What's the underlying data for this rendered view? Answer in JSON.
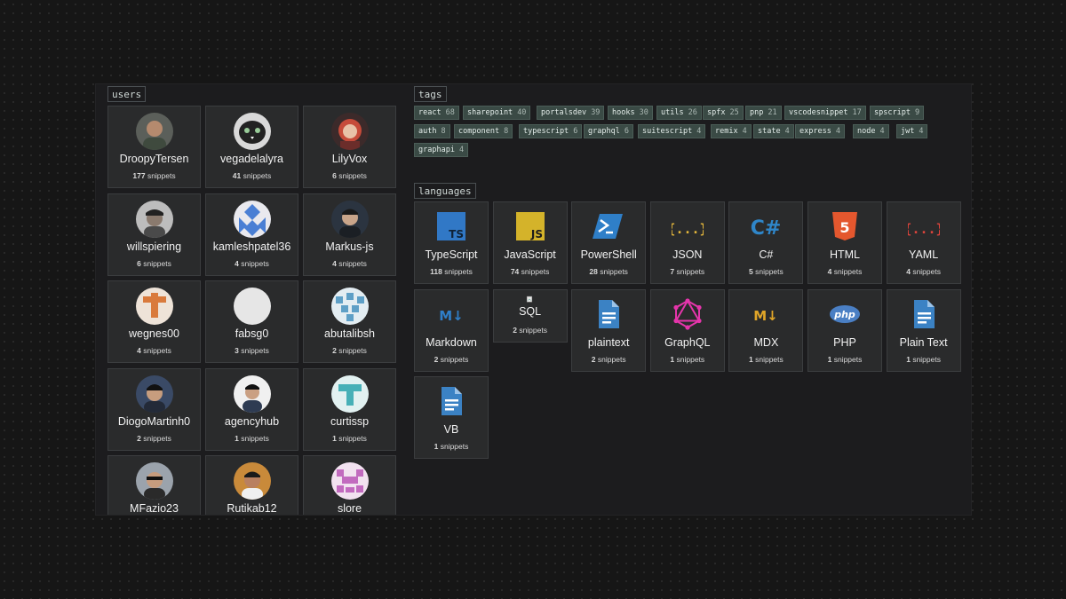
{
  "sections": {
    "users": "users",
    "tags": "tags",
    "languages": "languages"
  },
  "snippets_word": "snippets",
  "users": [
    {
      "name": "DroopyTersen",
      "count": "177"
    },
    {
      "name": "vegadelalyra",
      "count": "41"
    },
    {
      "name": "LilyVox",
      "count": "6"
    },
    {
      "name": "willspiering",
      "count": "6"
    },
    {
      "name": "kamleshpatel36",
      "count": "4"
    },
    {
      "name": "Markus-js",
      "count": "4"
    },
    {
      "name": "wegnes00",
      "count": "4"
    },
    {
      "name": "fabsg0",
      "count": "3"
    },
    {
      "name": "abutalibsh",
      "count": "2"
    },
    {
      "name": "DiogoMartinh0",
      "count": "2"
    },
    {
      "name": "agencyhub",
      "count": "1"
    },
    {
      "name": "curtissp",
      "count": "1"
    },
    {
      "name": "MFazio23",
      "count": ""
    },
    {
      "name": "Rutikab12",
      "count": ""
    },
    {
      "name": "slore",
      "count": ""
    }
  ],
  "tags": [
    {
      "name": "react",
      "count": "68"
    },
    {
      "name": "sharepoint",
      "count": "40"
    },
    {
      "name": "portalsdev",
      "count": "39"
    },
    {
      "name": "hooks",
      "count": "30"
    },
    {
      "name": "utils",
      "count": "26"
    },
    {
      "name": "spfx",
      "count": "25"
    },
    {
      "name": "pnp",
      "count": "21"
    },
    {
      "name": "vscodesnippet",
      "count": "17"
    },
    {
      "name": "spscript",
      "count": "9"
    },
    {
      "name": "auth",
      "count": "8"
    },
    {
      "name": "component",
      "count": "8"
    },
    {
      "name": "typescript",
      "count": "6"
    },
    {
      "name": "graphql",
      "count": "6"
    },
    {
      "name": "suitescript",
      "count": "4"
    },
    {
      "name": "remix",
      "count": "4"
    },
    {
      "name": "state",
      "count": "4"
    },
    {
      "name": "express",
      "count": "4"
    },
    {
      "name": "node",
      "count": "4"
    },
    {
      "name": "jwt",
      "count": "4"
    },
    {
      "name": "graphapi",
      "count": "4"
    }
  ],
  "languages": [
    {
      "name": "TypeScript",
      "count": "118",
      "icon": "typescript-icon",
      "color": "#3178c6",
      "label": "TS"
    },
    {
      "name": "JavaScript",
      "count": "74",
      "icon": "javascript-icon",
      "color": "#d4b32a",
      "label": "JS"
    },
    {
      "name": "PowerShell",
      "count": "28",
      "icon": "powershell-icon",
      "color": "#2f7fc8",
      "label": ""
    },
    {
      "name": "JSON",
      "count": "7",
      "icon": "json-icon",
      "color": "#e2b53b",
      "label": "{...}"
    },
    {
      "name": "C#",
      "count": "5",
      "icon": "csharp-icon",
      "color": "#2f86c9",
      "label": "C#"
    },
    {
      "name": "HTML",
      "count": "4",
      "icon": "html5-icon",
      "color": "#e4572e",
      "label": "5"
    },
    {
      "name": "YAML",
      "count": "4",
      "icon": "yaml-icon",
      "color": "#d9433b",
      "label": "{...}"
    },
    {
      "name": "Markdown",
      "count": "2",
      "icon": "markdown-icon",
      "color": "#2f7fc8",
      "label": "M↓"
    },
    {
      "name": "SQL",
      "count": "2",
      "icon": "broken-image-icon",
      "color": "#888888",
      "label": ""
    },
    {
      "name": "plaintext",
      "count": "2",
      "icon": "document-icon",
      "color": "#3b82c4",
      "label": ""
    },
    {
      "name": "GraphQL",
      "count": "1",
      "icon": "graphql-icon",
      "color": "#e535ab",
      "label": ""
    },
    {
      "name": "MDX",
      "count": "1",
      "icon": "mdx-icon",
      "color": "#e0a528",
      "label": "M↓"
    },
    {
      "name": "PHP",
      "count": "1",
      "icon": "php-icon",
      "color": "#4a7fc4",
      "label": "php"
    },
    {
      "name": "Plain Text",
      "count": "1",
      "icon": "document-icon",
      "color": "#3b82c4",
      "label": ""
    },
    {
      "name": "VB",
      "count": "1",
      "icon": "document-icon",
      "color": "#3b82c4",
      "label": ""
    }
  ]
}
